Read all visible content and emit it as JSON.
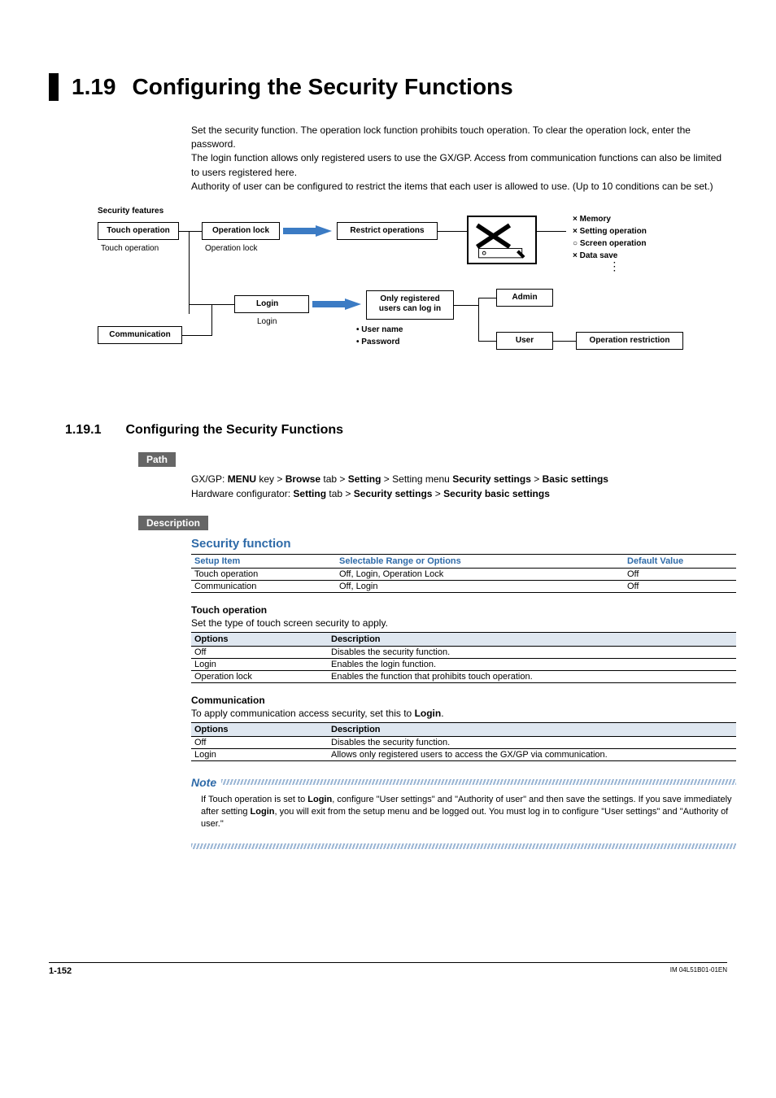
{
  "section": {
    "number": "1.19",
    "title": "Configuring the Security Functions"
  },
  "intro": {
    "p1": "Set the security function. The operation lock function prohibits touch operation. To clear the operation lock, enter the password.",
    "p2": "The login function allows only registered users to use the GX/GP. Access from communication functions can also be limited to users registered here.",
    "p3": "Authority of user can be configured to restrict the items that each user is allowed to use. (Up to 10 conditions can be set.)"
  },
  "diagram": {
    "caption": "Security features",
    "touch_op_box": "Touch operation",
    "touch_op_sub": "Touch operation",
    "op_lock_box": "Operation lock",
    "op_lock_sub": "Operation lock",
    "restrict_box": "Restrict operations",
    "bullets": {
      "b1": "× Memory",
      "b2": "× Setting operation",
      "b3": "○ Screen operation",
      "b4": "× Data save"
    },
    "login_box": "Login",
    "login_sub": "Login",
    "only_reg_line1": "Only registered",
    "only_reg_line2": "users can log in",
    "user_name": "• User name",
    "password": "• Password",
    "comm_box": "Communication",
    "admin_box": "Admin",
    "user_box": "User",
    "op_restrict_box": "Operation restriction"
  },
  "subsection": {
    "number": "1.19.1",
    "title": "Configuring the Security Functions"
  },
  "labels": {
    "path": "Path",
    "description": "Description",
    "note": "Note"
  },
  "path": {
    "gxgp_lead": "GX/GP: ",
    "menu": "MENU",
    "key_gt": " key > ",
    "browse": "Browse",
    "tab_gt": " tab > ",
    "setting": "Setting",
    "gt": " > ",
    "setting_menu": " Setting menu ",
    "security_settings": "Security settings",
    "basic_settings": "Basic settings",
    "hw_lead": "Hardware configurator: ",
    "hw_setting": "Setting",
    "hw_sec": "Security settings",
    "hw_basic": "Security basic settings"
  },
  "security_function": {
    "heading": "Security function",
    "head_setup": "Setup Item",
    "head_range": "Selectable Range or Options",
    "head_default": "Default Value",
    "rows": [
      {
        "item": "Touch operation",
        "range": "Off, Login, Operation Lock",
        "def": "Off"
      },
      {
        "item": "Communication",
        "range": "Off, Login",
        "def": "Off"
      }
    ]
  },
  "touch_operation": {
    "heading": "Touch operation",
    "lead": "Set the type of touch screen security to apply.",
    "head_opt": "Options",
    "head_desc": "Description",
    "rows": [
      {
        "opt": "Off",
        "desc": "Disables the security function."
      },
      {
        "opt": "Login",
        "desc": "Enables the login function."
      },
      {
        "opt": "Operation lock",
        "desc": "Enables the function that prohibits touch operation."
      }
    ]
  },
  "communication": {
    "heading": "Communication",
    "lead_a": "To apply communication access security, set this to ",
    "lead_b": "Login",
    "lead_c": ".",
    "head_opt": "Options",
    "head_desc": "Description",
    "rows": [
      {
        "opt": "Off",
        "desc": "Disables the security function."
      },
      {
        "opt": "Login",
        "desc": "Allows only registered users to access the GX/GP via communication."
      }
    ]
  },
  "note": {
    "a": "If Touch operation is set to ",
    "b": "Login",
    "c": ", configure \"User settings\" and \"Authority of user\" and then save the settings. If you save immediately after setting ",
    "d": "Login",
    "e": ", you will exit from the setup menu and be logged out. You must log in to configure \"User settings\" and \"Authority of user.\""
  },
  "footer": {
    "page": "1-152",
    "doc": "IM 04L51B01-01EN"
  }
}
